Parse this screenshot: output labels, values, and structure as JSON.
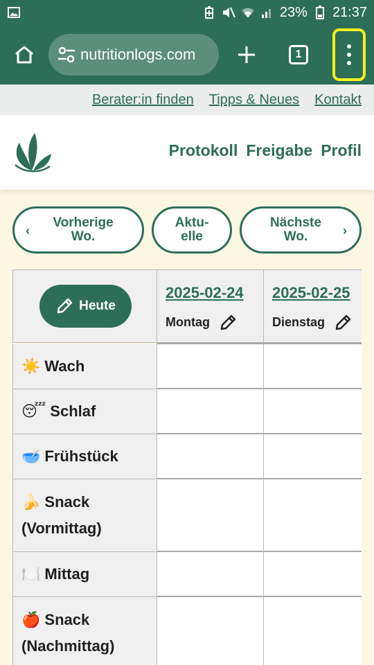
{
  "status": {
    "battery": "23%",
    "time": "21:37"
  },
  "browser": {
    "url": "nutritionlogs.com",
    "tab_count": "1"
  },
  "toplinks": [
    "Berater:in finden",
    "Tipps & Neues",
    "Kontakt"
  ],
  "nav": [
    "Protokoll",
    "Freigabe",
    "Profil"
  ],
  "week_buttons": {
    "prev": "Vorherige\nWo.",
    "current": "Aktu-\nelle",
    "next": "Nächste\nWo."
  },
  "table": {
    "today_label": "Heute",
    "days": [
      {
        "date": "2025-02-24",
        "weekday": "Montag"
      },
      {
        "date": "2025-02-25",
        "weekday": "Dienstag"
      }
    ],
    "rows": [
      {
        "emoji": "☀️",
        "label": "Wach"
      },
      {
        "emoji": "😴",
        "label": "Schlaf"
      },
      {
        "emoji": "🥣",
        "label": "Frühstück"
      },
      {
        "emoji": "🍌",
        "label": "Snack (Vormittag)"
      },
      {
        "emoji": "🍽️",
        "label": "Mittag"
      },
      {
        "emoji": "🍎",
        "label": "Snack (Nachmittag)"
      }
    ]
  },
  "colors": {
    "brand": "#2d6e58",
    "highlight": "#f5ef1d",
    "page_bg": "#fcf7e3"
  }
}
